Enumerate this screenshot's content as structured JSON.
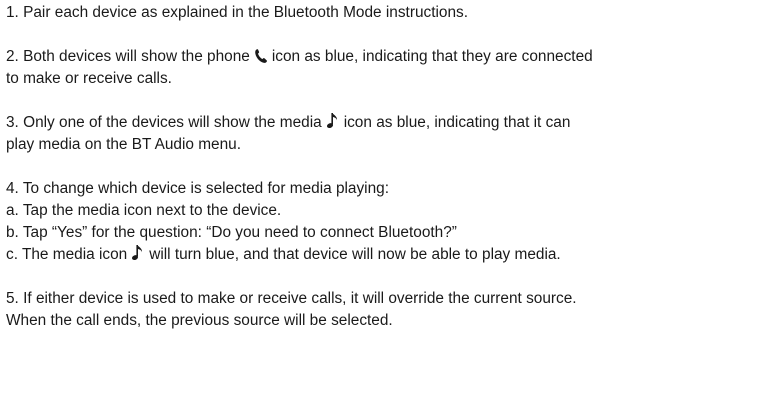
{
  "step1": {
    "text": "1. Pair each device as explained in the Bluetooth Mode instructions."
  },
  "step2": {
    "before": "2. Both devices will show the phone",
    "icon": "phone-icon",
    "after": "icon as blue, indicating that they are connected",
    "line2": "to make or receive calls."
  },
  "step3": {
    "before": "3. Only one of the devices will show the media",
    "icon": "music-note-icon",
    "after": "icon as blue, indicating that it can",
    "line2": "play media on the BT Audio menu."
  },
  "step4": {
    "heading": "4. To change which device is selected for media playing:",
    "a": "a. Tap the media icon next to the device.",
    "b": "b. Tap “Yes” for the question: “Do you need to connect Bluetooth?”",
    "c_before": "c. The media icon",
    "c_icon": "music-note-icon",
    "c_after": "will turn blue, and that device will now be able to play media."
  },
  "step5": {
    "line1": "5. If either device is used to make or receive calls, it will override the current source.",
    "line2": "When the call ends, the previous source will be selected."
  }
}
